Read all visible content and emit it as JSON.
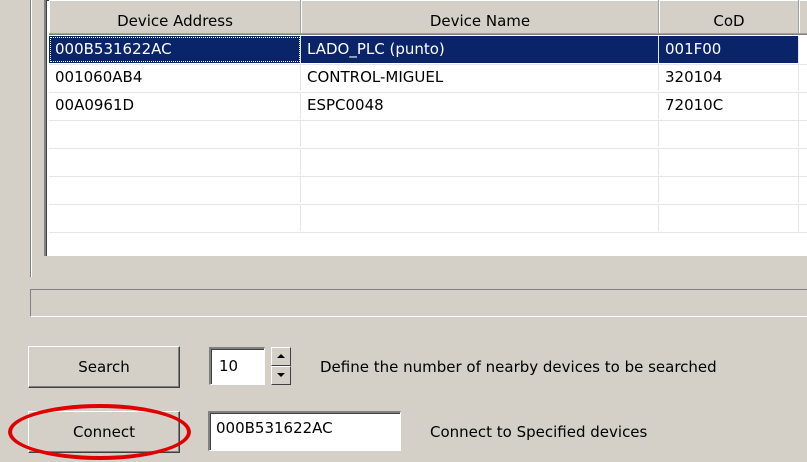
{
  "device_list": {
    "columns": [
      "Device Address",
      "Device Name",
      "CoD"
    ],
    "rows": [
      {
        "address": "000B531622AC",
        "name": "LADO_PLC (punto)",
        "cod": "001F00",
        "selected": true
      },
      {
        "address": "001060AB4",
        "name": "CONTROL-MIGUEL",
        "cod": "320104",
        "selected": false
      },
      {
        "address": "00A0961D",
        "name": "ESPC0048",
        "cod": "72010C",
        "selected": false
      }
    ],
    "empty_rows": 4
  },
  "search": {
    "button_label": "Search",
    "count_value": "10",
    "description": "Define the number of nearby devices to be searched"
  },
  "connect": {
    "button_label": "Connect",
    "device_value": "000B531622AC",
    "description": "Connect to Specified devices"
  },
  "colors": {
    "selection": "#0a246a",
    "window_bg": "#d4d0c8",
    "annotation": "#e00000"
  }
}
